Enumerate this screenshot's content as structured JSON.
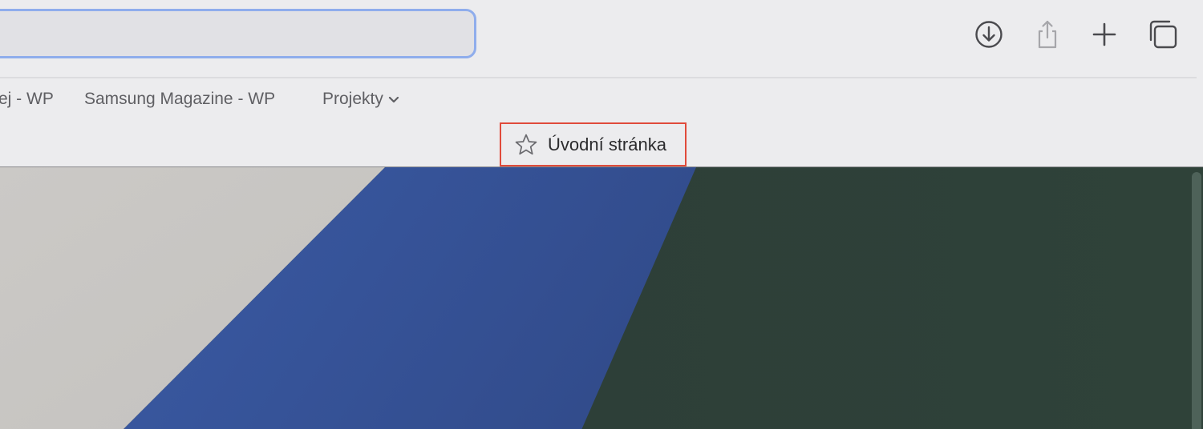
{
  "favorites": {
    "items": [
      {
        "label": "ej - WP"
      },
      {
        "label": "Samsung Magazine - WP"
      },
      {
        "label": "Projekty"
      }
    ]
  },
  "tab": {
    "start_page_label": "Úvodní stránka"
  },
  "toolbar": {
    "icons": [
      "download-icon",
      "share-icon",
      "plus-icon",
      "tabs-overview-icon"
    ]
  },
  "colors": {
    "address_border": "#8fadec",
    "highlight_border": "#e04b3b",
    "wallpaper_gray": "#cdcbc8",
    "wallpaper_blue": "#36549a",
    "wallpaper_green": "#2f4239"
  }
}
